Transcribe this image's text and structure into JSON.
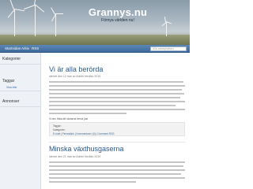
{
  "site": {
    "title": "Grannys.nu",
    "tagline": "Förnya världen nu!"
  },
  "nav": {
    "items": [
      "Startsidan",
      "Arkiv",
      "RSS"
    ],
    "search_placeholder": "Sök webbplatsen"
  },
  "sidebar": {
    "sections": [
      {
        "title": "Kategorier",
        "links": []
      },
      {
        "title": "Taggar",
        "links": [
          "Visa inte"
        ]
      },
      {
        "title": "Annonser",
        "links": []
      }
    ]
  },
  "posts": [
    {
      "title": "Vi är alla berörda",
      "meta": "skrivet den 12 mar av Admin hbvifan 2019",
      "caption": "Vi den fösta att växlarna berna just",
      "footer": {
        "tags_label": "Taggar:",
        "category_label": "Kategorier:",
        "links": [
          "E-mail",
          "Permalänk",
          "Kommentarer (0)",
          "Comment RSS"
        ]
      }
    },
    {
      "title": "Minska växthusgaserna",
      "meta": "skrivet den 21 mar av Admin hbvifan 2019"
    }
  ],
  "colors": {
    "nav_blue": "#3d6a9b",
    "title_blue": "#2c5a8a",
    "sidebar_bg": "#eef1f5"
  }
}
